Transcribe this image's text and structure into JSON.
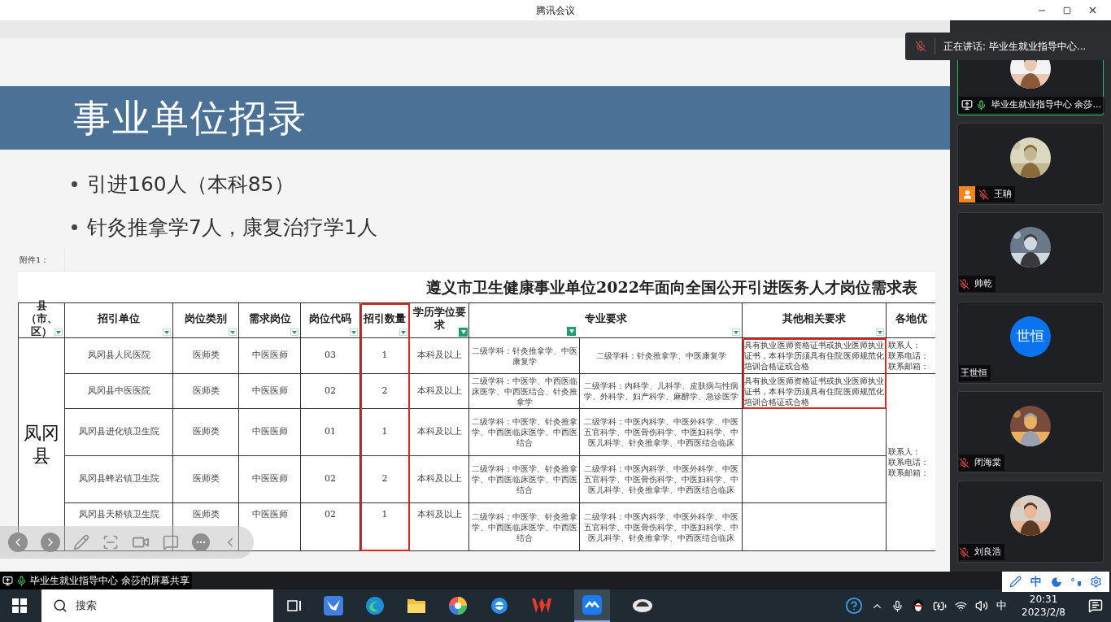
{
  "window": {
    "title": "腾讯会议"
  },
  "slide": {
    "title": "事业单位招录",
    "bullets": [
      "引进160人（本科85）",
      "针灸推拿学7人，康复治疗学1人"
    ],
    "sheet": {
      "attachment_label": "附件1：",
      "title": "遵义市卫生健康事业单位2022年面向全国公开引进医务人才岗位需求表",
      "county": "凤冈县",
      "columns": [
        {
          "label": "县（市、区）",
          "kind": "dropdown",
          "highlighted": false
        },
        {
          "label": "招引单位",
          "kind": "dropdown",
          "highlighted": false
        },
        {
          "label": "岗位类别",
          "kind": "dropdown",
          "highlighted": false
        },
        {
          "label": "需求岗位",
          "kind": "dropdown",
          "highlighted": false
        },
        {
          "label": "岗位代码",
          "kind": "dropdown",
          "highlighted": false
        },
        {
          "label": "招引数量",
          "kind": "dropdown",
          "highlighted": true
        },
        {
          "label": "学历学位要求",
          "kind": "funnel",
          "highlighted": false
        },
        {
          "label": "专业要求",
          "kind": "split",
          "highlighted": false
        },
        {
          "label": "其他相关要求",
          "kind": "dropdown",
          "highlighted": false
        },
        {
          "label": "各地优",
          "kind": "plain",
          "highlighted": false
        }
      ],
      "rows": [
        {
          "unit": "凤冈县人民医院",
          "category": "医师类",
          "post": "中医医师",
          "code": "03",
          "count": "1",
          "education": "本科及以上",
          "major_1": "二级学科：针灸推拿学、中医康复学",
          "major_2": "二级学科：针灸推拿学、中医康复学",
          "other": "具有执业医师资格证书或执业医师执业证书，本科学历须具有住院医师规范化培训合格证或合格",
          "other_highlighted": true,
          "contact": [
            "联系人：",
            "联系电话：",
            "联系邮箱："
          ]
        },
        {
          "unit": "凤冈县中医医院",
          "category": "医师类",
          "post": "中医医师",
          "code": "02",
          "count": "2",
          "education": "本科及以上",
          "major_1": "二级学科：中医学、中西医临床医学、中西医结合、针灸推拿学",
          "major_2": "二级学科：内科学、儿科学、皮肤病与性病学、外科学、妇产科学、麻醉学、急诊医学",
          "other": "具有执业医师资格证书或执业医师执业证书，本科学历须具有住院医师规范化培训合格证或合格",
          "other_highlighted": true,
          "contact": [
            "联系人：",
            "联系电话：",
            "联系邮箱："
          ]
        },
        {
          "unit": "凤冈县进化镇卫生院",
          "category": "医师类",
          "post": "中医医师",
          "code": "01",
          "count": "1",
          "education": "本科及以上",
          "major_1": "二级学科：中医学、针灸推拿学、中西医临床医学、中西医结合",
          "major_2": "二级学科：中医内科学、中医外科学、中医五官科学、中医骨伤科学、中医妇科学、中医儿科学、针灸推拿学、中西医结合临床",
          "other_highlighted": false
        },
        {
          "unit": "凤冈县蜂岩镇卫生院",
          "category": "医师类",
          "post": "中医医师",
          "code": "02",
          "count": "2",
          "education": "本科及以上",
          "major_1": "二级学科：中医学、针灸推拿学、中西医临床医学、中西医结合",
          "major_2": "二级学科：中医内科学、中医外科学、中医五官科学、中医骨伤科学、中医妇科学、中医儿科学、针灸推拿学、中西医结合临床",
          "other_highlighted": false
        },
        {
          "unit": "凤冈县天桥镇卫生院",
          "category": "医师类",
          "post": "中医医师",
          "code": "02",
          "count": "1",
          "education": "本科及以上",
          "major_1": "二级学科：中医学、针灸推拿学、中西医临床医学、中西医结合",
          "major_2": "二级学科：中医内科学、中医外科学、中医五官科学、中医骨伤科学、中医妇科学、中医儿科学、针灸推拿学、中西医结合临床",
          "other_highlighted": false
        }
      ]
    }
  },
  "speaking_toast": {
    "text": "正在讲话: 毕业生就业指导中心..."
  },
  "participants": [
    {
      "name": "毕业生就业指导中心 余莎...",
      "kind": "picture",
      "mic_visible": true,
      "muted": false,
      "sharing": true,
      "host": false,
      "selected": true
    },
    {
      "name": "王聃",
      "kind": "picture",
      "mic_visible": true,
      "muted": true,
      "sharing": false,
      "host": true,
      "selected": false
    },
    {
      "name": "帅乾",
      "kind": "picture",
      "mic_visible": true,
      "muted": true,
      "sharing": false,
      "host": false,
      "selected": false
    },
    {
      "name": "王世恒",
      "kind": "initials",
      "initials": "世恒",
      "mic_visible": false,
      "sharing": false,
      "host": false,
      "selected": false
    },
    {
      "name": "闭海棠",
      "kind": "picture",
      "mic_visible": true,
      "muted": true,
      "sharing": false,
      "host": false,
      "selected": false
    },
    {
      "name": "刘良浩",
      "kind": "picture",
      "mic_visible": true,
      "muted": true,
      "sharing": false,
      "host": false,
      "selected": false
    }
  ],
  "share_bar": {
    "text": "毕业生就业指导中心 余莎的屏幕共享"
  },
  "ime_bar": {
    "mode": "中"
  },
  "taskbar": {
    "search_placeholder": "搜索",
    "input_mode": "中",
    "time": "20:31",
    "date": "2023/2/8"
  }
}
